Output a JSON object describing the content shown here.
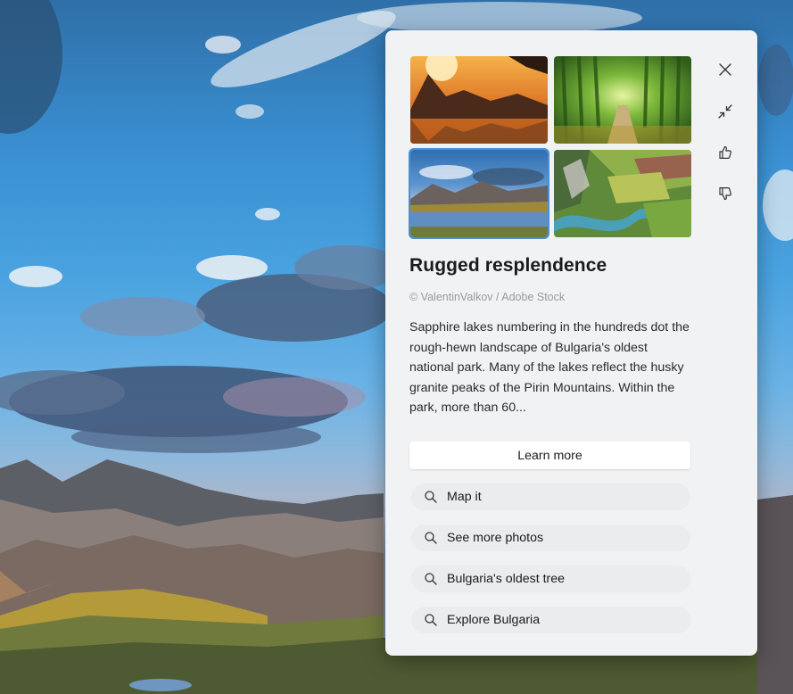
{
  "panel": {
    "title": "Rugged resplendence",
    "credit": "© ValentinValkov / Adobe Stock",
    "description": "Sapphire lakes numbering in the hundreds dot the rough-hewn landscape of Bulgaria's oldest national park. Many of the lakes reflect the husky granite peaks of the Pirin Mountains. Within the park, more than 60...",
    "learn_more_label": "Learn more",
    "thumbnails": [
      {
        "icon": "sunset-lake-thumbnail"
      },
      {
        "icon": "bamboo-forest-thumbnail"
      },
      {
        "icon": "mountain-lake-thumbnail",
        "selected": true
      },
      {
        "icon": "aerial-valley-thumbnail"
      }
    ],
    "side_icons": [
      "close-icon",
      "collapse-icon",
      "thumbs-up-icon",
      "thumbs-down-icon"
    ],
    "searches": [
      {
        "label": "Map it",
        "icon": "search-icon"
      },
      {
        "label": "See more photos",
        "icon": "search-icon"
      },
      {
        "label": "Bulgaria's oldest tree",
        "icon": "search-icon"
      },
      {
        "label": "Explore Bulgaria",
        "icon": "search-icon"
      }
    ]
  }
}
